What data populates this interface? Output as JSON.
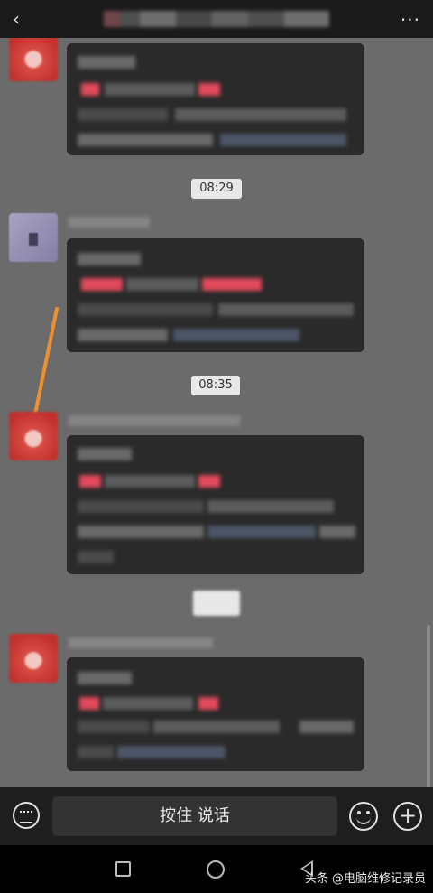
{
  "chat": {
    "timestamps": [
      "08:29",
      "08:35"
    ]
  },
  "input_bar": {
    "hold_to_talk_label": "按住 说话"
  },
  "watermark": {
    "text": "头条 @电脑维修记录员"
  },
  "colors": {
    "chat_background": "#6b6b6b",
    "bubble": "#2a2a2a",
    "bar": "#1e1e1e",
    "arrow": "#f0902c"
  }
}
